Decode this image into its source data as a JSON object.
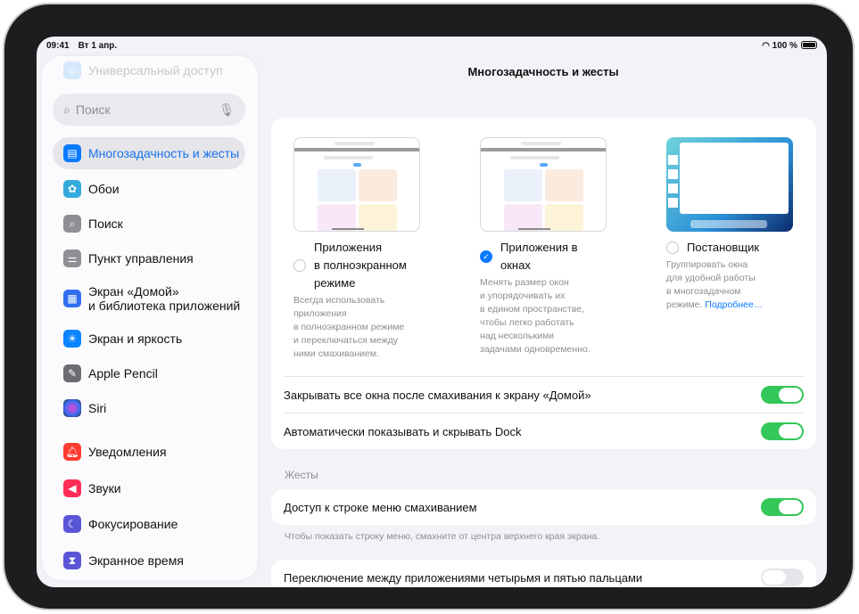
{
  "status": {
    "time": "09:41",
    "date": "Вт 1 апр.",
    "battery": "100 %"
  },
  "sidebar": {
    "search_placeholder": "Поиск",
    "items": [
      {
        "label": "Универсальный доступ",
        "icon": "accessibility-icon",
        "color": "#cfe3fb"
      },
      {
        "label": "Многозадачность и жесты",
        "icon": "multitasking-icon",
        "color": "#0a7aff"
      },
      {
        "label": "Обои",
        "icon": "wallpaper-icon",
        "color": "#34aadc"
      },
      {
        "label": "Поиск",
        "icon": "search-icon",
        "color": "#8e8e93"
      },
      {
        "label": "Пункт управления",
        "icon": "control-center-icon",
        "color": "#8e8e93"
      },
      {
        "label": "Экран «Домой»\nи библиотека приложений",
        "line1": "Экран «Домой»",
        "line2": "и библиотека приложений",
        "icon": "home-screen-icon",
        "color": "#2f6ff0"
      },
      {
        "label": "Экран и яркость",
        "icon": "brightness-icon",
        "color": "#0a84ff"
      },
      {
        "label": "Apple Pencil",
        "icon": "pencil-icon",
        "color": "#6b6b70"
      },
      {
        "label": "Siri",
        "icon": "siri-icon",
        "color": "#222"
      },
      {
        "label": "Уведомления",
        "icon": "notifications-icon",
        "color": "#ff3b30"
      },
      {
        "label": "Звуки",
        "icon": "sounds-icon",
        "color": "#ff2d55"
      },
      {
        "label": "Фокусирование",
        "icon": "focus-icon",
        "color": "#5856d6"
      },
      {
        "label": "Экранное время",
        "icon": "screen-time-icon",
        "color": "#5856d6"
      }
    ]
  },
  "main": {
    "title": "Многозадачность и жесты",
    "options": [
      {
        "label_lines": [
          "Приложения",
          "в полноэкранном",
          "режиме"
        ],
        "desc_lines": [
          "Всегда использовать",
          "приложения",
          "в полноэкранном режиме",
          "и переключаться между",
          "ними смахиванием."
        ],
        "selected": false
      },
      {
        "label": "Приложения в окнах",
        "desc_lines": [
          "Менять размер окон",
          "и упорядочивать их",
          "в едином пространстве,",
          "чтобы легко работать",
          "над несколькими",
          "задачами одновременно."
        ],
        "selected": true
      },
      {
        "label": "Постановщик",
        "desc_lines": [
          "Группировать окна",
          "для удобной работы",
          "в многозадачном"
        ],
        "desc_last": "режиме.",
        "link": "Подробнее…",
        "selected": false
      }
    ],
    "rows": [
      {
        "label": "Закрывать все окна после смахивания к экрану «Домой»",
        "on": true
      },
      {
        "label": "Автоматически показывать и скрывать Dock",
        "on": true
      }
    ],
    "gestures_header": "Жесты",
    "gesture_rows": [
      {
        "label": "Доступ к строке меню смахиванием",
        "on": true,
        "footnote": "Чтобы показать строку меню, смахните от центра верхнего края экрана."
      },
      {
        "label": "Переключение между приложениями четырьмя и пятью пальцами",
        "on": false
      }
    ]
  }
}
